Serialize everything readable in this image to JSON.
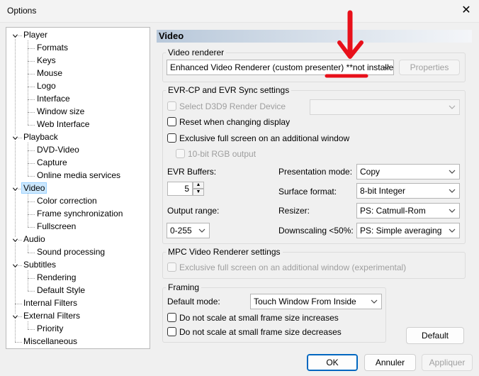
{
  "window": {
    "title": "Options",
    "close_glyph": "✕"
  },
  "tree": [
    {
      "label": "Player",
      "level": 0,
      "toggle": "collapse"
    },
    {
      "label": "Formats",
      "level": 1
    },
    {
      "label": "Keys",
      "level": 1
    },
    {
      "label": "Mouse",
      "level": 1
    },
    {
      "label": "Logo",
      "level": 1
    },
    {
      "label": "Interface",
      "level": 1
    },
    {
      "label": "Window size",
      "level": 1
    },
    {
      "label": "Web Interface",
      "level": 1
    },
    {
      "label": "Playback",
      "level": 0,
      "toggle": "collapse"
    },
    {
      "label": "DVD-Video",
      "level": 1
    },
    {
      "label": "Capture",
      "level": 1
    },
    {
      "label": "Online media services",
      "level": 1
    },
    {
      "label": "Video",
      "level": 0,
      "toggle": "collapse",
      "selected": true
    },
    {
      "label": "Color correction",
      "level": 1
    },
    {
      "label": "Frame synchronization",
      "level": 1
    },
    {
      "label": "Fullscreen",
      "level": 1
    },
    {
      "label": "Audio",
      "level": 0,
      "toggle": "collapse"
    },
    {
      "label": "Sound processing",
      "level": 1
    },
    {
      "label": "Subtitles",
      "level": 0,
      "toggle": "collapse"
    },
    {
      "label": "Rendering",
      "level": 1
    },
    {
      "label": "Default Style",
      "level": 1
    },
    {
      "label": "Internal Filters",
      "level": 0
    },
    {
      "label": "External Filters",
      "level": 0,
      "toggle": "collapse"
    },
    {
      "label": "Priority",
      "level": 1
    },
    {
      "label": "Miscellaneous",
      "level": 0
    }
  ],
  "page": {
    "header": "Video",
    "video_renderer": {
      "group_label": "Video renderer",
      "selected": "Enhanced Video Renderer (custom presenter) **not installed*",
      "properties_button": "Properties"
    },
    "evr": {
      "group_label": "EVR-CP and EVR Sync settings",
      "select_d3d9": "Select D3D9 Render Device",
      "d3d9_device": "",
      "reset_on_change": "Reset when changing display",
      "exclusive_fullscreen": "Exclusive full screen on an additional window",
      "rgb_10bit": "10-bit RGB output",
      "buffers_label": "EVR Buffers:",
      "buffers_value": "5",
      "output_range_label": "Output range:",
      "output_range_value": "0-255",
      "presentation_mode_label": "Presentation mode:",
      "presentation_mode_value": "Copy",
      "surface_format_label": "Surface format:",
      "surface_format_value": "8-bit Integer",
      "resizer_label": "Resizer:",
      "resizer_value": "PS: Catmull-Rom",
      "downscaling_label": "Downscaling <50%:",
      "downscaling_value": "PS: Simple averaging"
    },
    "mpc_vr": {
      "group_label": "MPC Video Renderer settings",
      "exclusive_fullscreen": "Exclusive full screen on an additional window (experimental)"
    },
    "framing": {
      "group_label": "Framing",
      "default_mode_label": "Default mode:",
      "default_mode_value": "Touch Window From Inside",
      "no_scale_increase": "Do not scale at small frame size increases",
      "no_scale_decrease": "Do not scale at small frame size decreases"
    },
    "default_button": "Default"
  },
  "footer": {
    "ok": "OK",
    "cancel": "Annuler",
    "apply": "Appliquer"
  },
  "colors": {
    "annotation": "#e8101a",
    "accent": "#0067c0",
    "selection": "#cce8ff"
  },
  "icons": {
    "collapse": "chevron-down-icon",
    "dropdown": "chevron-down-icon",
    "annotation": "down-arrow-icon"
  }
}
